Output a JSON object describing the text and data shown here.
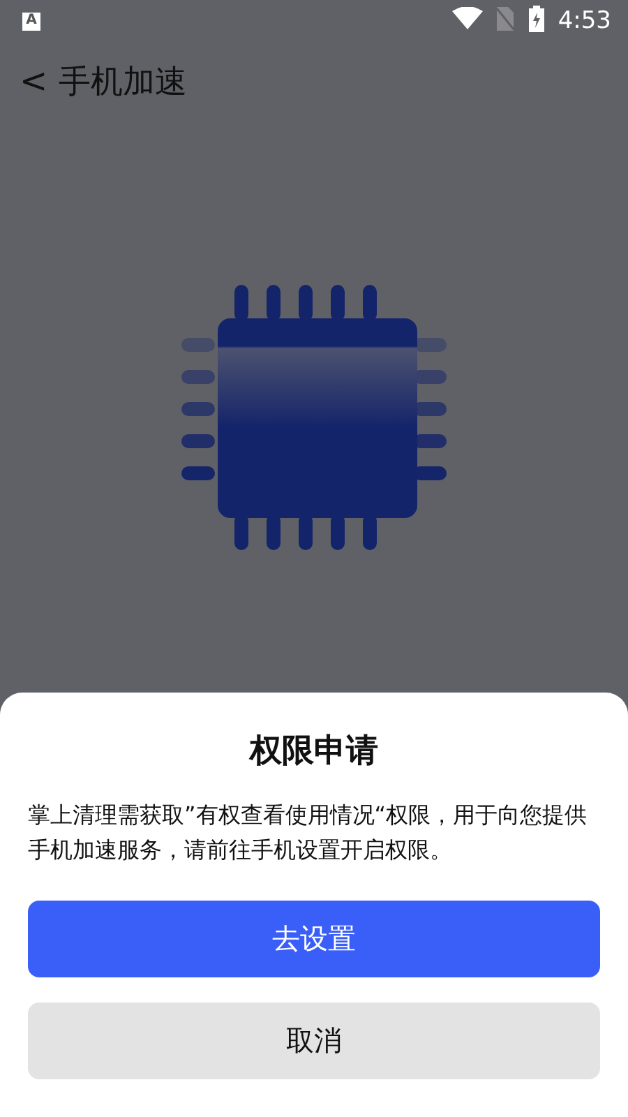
{
  "status_bar": {
    "app_badge": "A",
    "time": "4:53",
    "wifi_on": true,
    "sim_present": false,
    "charging": true
  },
  "header": {
    "back": "<",
    "title": "手机加速"
  },
  "dialog": {
    "title": "权限申请",
    "message": "掌上清理需获取”有权查看使用情况“权限，用于向您提供手机加速服务，请前往手机设置开启权限。",
    "buttons": [
      {
        "label": "去设置",
        "kind": "primary"
      },
      {
        "label": "取消",
        "kind": "secondary"
      }
    ]
  }
}
